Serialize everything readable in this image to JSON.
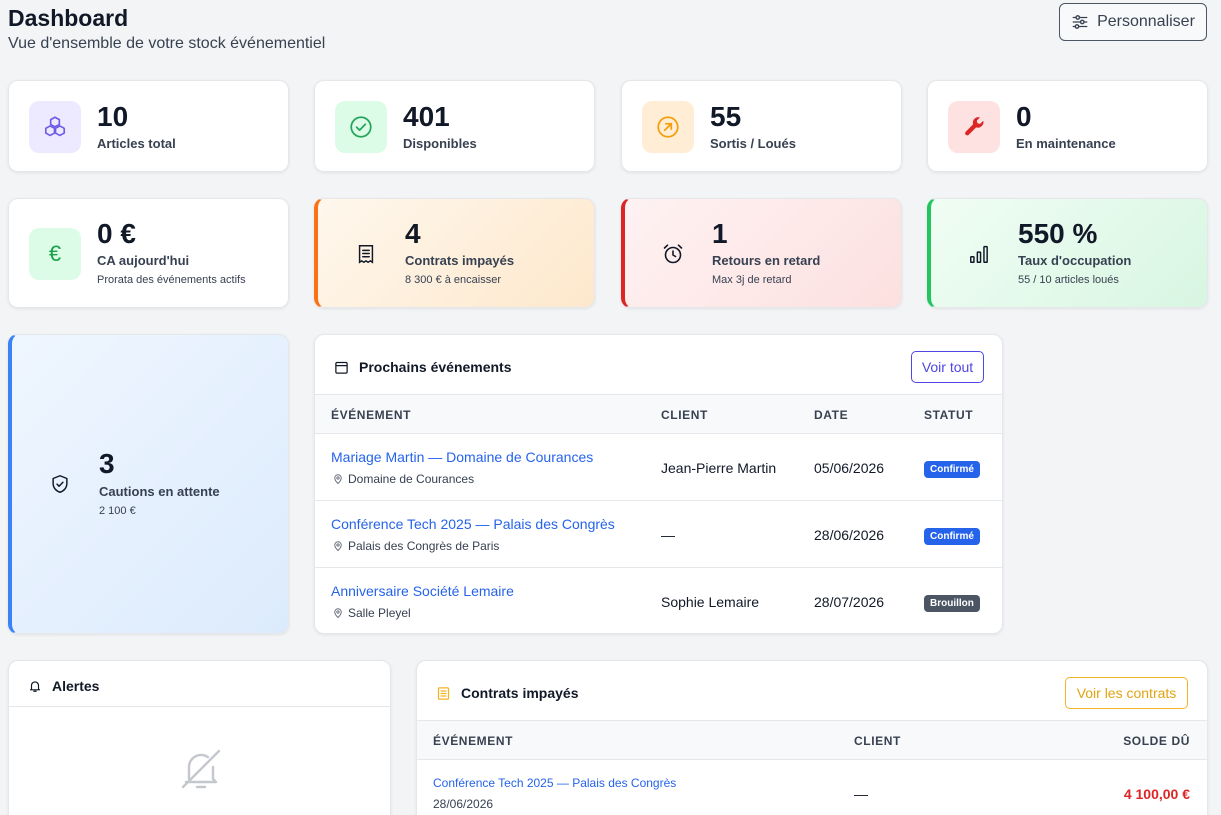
{
  "header": {
    "title": "Dashboard",
    "subtitle": "Vue d'ensemble de votre stock événementiel",
    "customize_label": "Personnaliser"
  },
  "stats_row1": [
    {
      "value": "10",
      "label": "Articles total",
      "icon": "cubes-icon"
    },
    {
      "value": "401",
      "label": "Disponibles",
      "icon": "check-circle-icon"
    },
    {
      "value": "55",
      "label": "Sortis / Loués",
      "icon": "arrow-up-right-circle-icon"
    },
    {
      "value": "0",
      "label": "En maintenance",
      "icon": "wrench-icon"
    }
  ],
  "stats_row2": [
    {
      "value": "0 €",
      "label": "CA aujourd'hui",
      "sub": "Prorata des événements actifs",
      "icon": "euro-icon"
    },
    {
      "value": "4",
      "label": "Contrats impayés",
      "sub": "8 300 € à encaisser",
      "icon": "receipt-icon"
    },
    {
      "value": "1",
      "label": "Retours en retard",
      "sub": "Max 3j de retard",
      "icon": "alarm-icon"
    },
    {
      "value": "550 %",
      "label": "Taux d'occupation",
      "sub": "55 / 10 articles loués",
      "icon": "bar-chart-icon"
    }
  ],
  "deposits": {
    "value": "3",
    "label": "Cautions en attente",
    "sub": "2 100 €",
    "icon": "shield-check-icon"
  },
  "events": {
    "title": "Prochains événements",
    "view_all": "Voir tout",
    "columns": [
      "ÉVÉNEMENT",
      "CLIENT",
      "DATE",
      "STATUT"
    ],
    "rows": [
      {
        "title": "Mariage Martin — Domaine de Courances",
        "location": "Domaine de Courances",
        "client": "Jean-Pierre Martin",
        "date": "05/06/2026",
        "status": "Confirmé"
      },
      {
        "title": "Conférence Tech 2025 — Palais des Congrès",
        "location": "Palais des Congrès de Paris",
        "client": "—",
        "date": "28/06/2026",
        "status": "Confirmé"
      },
      {
        "title": "Anniversaire Société Lemaire",
        "location": "Salle Pleyel",
        "client": "Sophie Lemaire",
        "date": "28/07/2026",
        "status": "Brouillon"
      }
    ]
  },
  "alerts": {
    "title": "Alertes"
  },
  "unpaid": {
    "title": "Contrats impayés",
    "view_all": "Voir les contrats",
    "columns": [
      "ÉVÉNEMENT",
      "CLIENT",
      "SOLDE DÛ"
    ],
    "rows": [
      {
        "title": "Conférence Tech 2025 — Palais des Congrès",
        "date": "28/06/2026",
        "client": "—",
        "balance": "4 100,00 €"
      }
    ]
  },
  "colors": {
    "accent": "#2563eb",
    "confirmed": "#2563eb",
    "draft": "#4b5563",
    "danger": "#dc2626",
    "warning": "#f59e0b",
    "success": "#22c55e"
  }
}
